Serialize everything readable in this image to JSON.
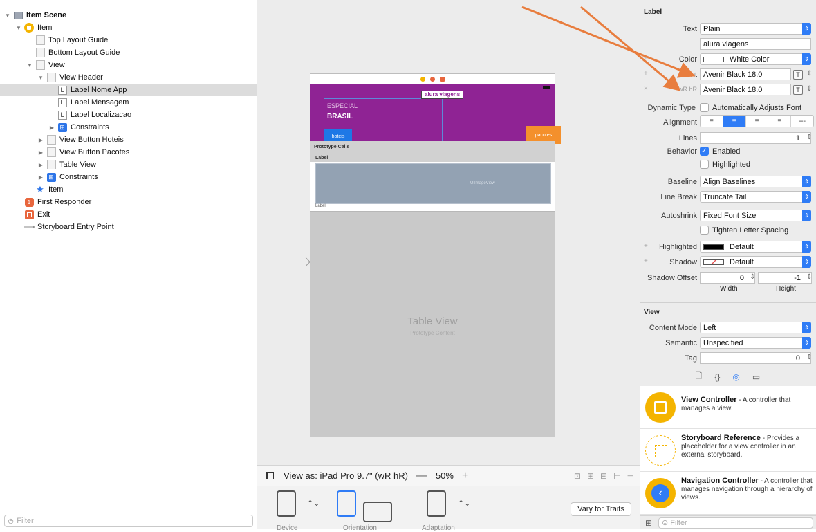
{
  "outline": {
    "rows": [
      {
        "label": "Item Scene",
        "indent": 0,
        "disc": "▼",
        "icon": "scene"
      },
      {
        "label": "Item",
        "indent": 1,
        "disc": "▼",
        "icon": "vc"
      },
      {
        "label": "Top Layout Guide",
        "indent": 2,
        "disc": "",
        "icon": "box"
      },
      {
        "label": "Bottom Layout Guide",
        "indent": 2,
        "disc": "",
        "icon": "box"
      },
      {
        "label": "View",
        "indent": 2,
        "disc": "▼",
        "icon": "box"
      },
      {
        "label": "View Header",
        "indent": 3,
        "disc": "▼",
        "icon": "box"
      },
      {
        "label": "Label Nome App",
        "indent": 4,
        "disc": "",
        "icon": "lbl"
      },
      {
        "label": "Label Mensagem",
        "indent": 4,
        "disc": "",
        "icon": "lbl"
      },
      {
        "label": "Label Localizacao",
        "indent": 4,
        "disc": "",
        "icon": "lbl"
      },
      {
        "label": "Constraints",
        "indent": 4,
        "disc": "▶",
        "icon": "cons"
      },
      {
        "label": "View Button Hoteis",
        "indent": 3,
        "disc": "▶",
        "icon": "box"
      },
      {
        "label": "View Button Pacotes",
        "indent": 3,
        "disc": "▶",
        "icon": "box"
      },
      {
        "label": "Table View",
        "indent": 3,
        "disc": "▶",
        "icon": "box"
      },
      {
        "label": "Constraints",
        "indent": 3,
        "disc": "▶",
        "icon": "cons"
      },
      {
        "label": "Item",
        "indent": 2,
        "disc": "",
        "icon": "star"
      },
      {
        "label": "First Responder",
        "indent": 1,
        "disc": "",
        "icon": "fr"
      },
      {
        "label": "Exit",
        "indent": 1,
        "disc": "",
        "icon": "exit"
      },
      {
        "label": "Storyboard Entry Point",
        "indent": 1,
        "disc": "",
        "icon": "arrow"
      }
    ],
    "selected_index": 6,
    "filter_placeholder": "Filter"
  },
  "canvas": {
    "app_name": "alura viagens",
    "especial": "ESPECIAL",
    "brasil": "BRASIL",
    "btn_hoteis": "hoteis",
    "btn_pacotes": "pacotes",
    "prototype_cells": "Prototype Cells",
    "label1": "Label",
    "uiimageview": "UIImageView",
    "label2": "Label",
    "tableview_title": "Table View",
    "tableview_sub": "Prototype Content",
    "header_color": "#8f2394"
  },
  "viewas": {
    "label": "View as: iPad Pro 9.7\" (wR hR)",
    "minus": "—",
    "zoom": "50%",
    "plus": "+"
  },
  "devicebar": {
    "device": "Device",
    "orientation": "Orientation",
    "adaptation": "Adaptation",
    "vary": "Vary for Traits"
  },
  "inspector": {
    "label_section": "Label",
    "text_lbl": "Text",
    "text_value": "Plain",
    "text_content": "alura viagens",
    "color_lbl": "Color",
    "color_value": "White Color",
    "font_lbl": "Font",
    "font_value": "Avenir Black 18.0",
    "wrhr_lbl": "wR hR",
    "wrhr_value": "Avenir Black 18.0",
    "dynamic_lbl": "Dynamic Type",
    "dynamic_value": "Automatically Adjusts Font",
    "alignment_lbl": "Alignment",
    "lines_lbl": "Lines",
    "lines_value": "1",
    "behavior_lbl": "Behavior",
    "enabled": "Enabled",
    "highlighted_chk": "Highlighted",
    "baseline_lbl": "Baseline",
    "baseline_value": "Align Baselines",
    "linebreak_lbl": "Line Break",
    "linebreak_value": "Truncate Tail",
    "autoshrink_lbl": "Autoshrink",
    "autoshrink_value": "Fixed Font Size",
    "tighten": "Tighten Letter Spacing",
    "highlighted_lbl": "Highlighted",
    "highlighted_value": "Default",
    "shadow_lbl": "Shadow",
    "shadow_value": "Default",
    "shadow_offset_lbl": "Shadow Offset",
    "offset_w": "0",
    "offset_h": "-1",
    "width_lbl": "Width",
    "height_lbl": "Height",
    "view_section": "View",
    "content_mode_lbl": "Content Mode",
    "content_mode_value": "Left",
    "semantic_lbl": "Semantic",
    "semantic_value": "Unspecified",
    "tag_lbl": "Tag",
    "tag_value": "0"
  },
  "library": {
    "items": [
      {
        "title": "View Controller",
        "desc": " - A controller that manages a view."
      },
      {
        "title": "Storyboard Reference",
        "desc": " - Provides a placeholder for a view controller in an external storyboard."
      },
      {
        "title": "Navigation Controller",
        "desc": " - A controller that manages navigation through a hierarchy of views."
      }
    ],
    "filter_placeholder": "Filter"
  },
  "colors": {
    "accent_blue": "#2f7cf6",
    "annotation_orange": "#e87d3e",
    "button_hoteis": "#1e78e6",
    "button_pacotes": "#f4902c"
  }
}
